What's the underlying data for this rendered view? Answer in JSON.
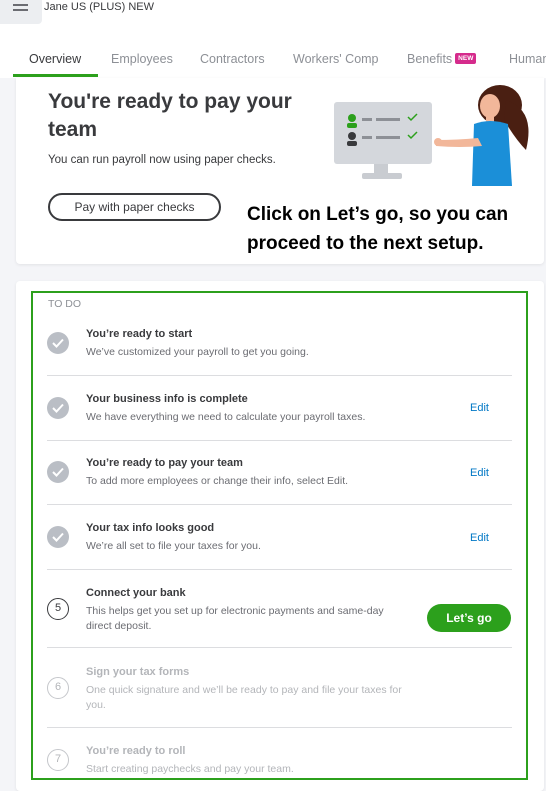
{
  "header": {
    "company": "Jane US (PLUS) NEW"
  },
  "tabs": [
    {
      "label": "Overview",
      "active": true
    },
    {
      "label": "Employees"
    },
    {
      "label": "Contractors"
    },
    {
      "label": "Workers' Comp"
    },
    {
      "label": "Benefits",
      "badge": "NEW"
    },
    {
      "label": "Human"
    }
  ],
  "hero": {
    "title": "You're ready to pay your team",
    "subtitle": "You can run payroll now using paper checks.",
    "button": "Pay with paper checks"
  },
  "annotation": "Click on Let’s go, so you can proceed to the next setup.",
  "todo": {
    "header": "TO DO",
    "items": [
      {
        "status": "done",
        "title": "You’re ready to start",
        "desc": "We’ve customized your payroll to get you going."
      },
      {
        "status": "done",
        "title": "Your business info is complete",
        "desc": "We have everything we need to calculate your payroll taxes.",
        "action": "Edit"
      },
      {
        "status": "done",
        "title": "You’re ready to pay your team",
        "desc": "To add more employees or change their info, select Edit.",
        "action": "Edit"
      },
      {
        "status": "done",
        "title": "Your tax info looks good",
        "desc": "We’re all set to file your taxes for you.",
        "action": "Edit"
      },
      {
        "status": "current",
        "step": "5",
        "title": "Connect your bank",
        "desc": "This helps get you set up for electronic payments and same-day direct deposit.",
        "action": "Let’s go"
      },
      {
        "status": "pending",
        "step": "6",
        "title": "Sign your tax forms",
        "desc": "One quick signature and we’ll be ready to pay and file your taxes for you."
      },
      {
        "status": "pending",
        "step": "7",
        "title": "You’re ready to roll",
        "desc": "Start creating paychecks and pay your team."
      }
    ]
  },
  "colors": {
    "accent_green": "#2ca01c",
    "link_blue": "#0077c5",
    "badge_pink": "#d52b8c"
  }
}
